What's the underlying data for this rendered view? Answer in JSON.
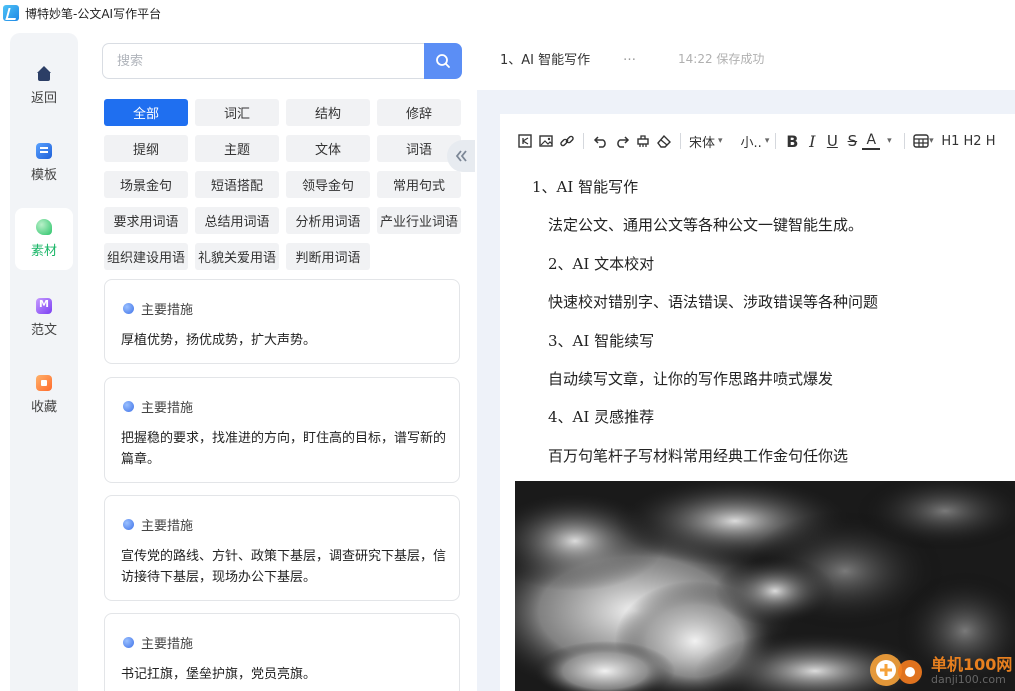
{
  "app": {
    "title": "博特妙笔-公文AI写作平台"
  },
  "nav": [
    {
      "label": "返回",
      "icon": "home-icon"
    },
    {
      "label": "模板",
      "icon": "template-icon"
    },
    {
      "label": "素材",
      "icon": "material-icon",
      "active": true
    },
    {
      "label": "范文",
      "icon": "sample-article-icon"
    },
    {
      "label": "收藏",
      "icon": "favorites-icon"
    }
  ],
  "search": {
    "placeholder": "搜索"
  },
  "tags": [
    "全部",
    "词汇",
    "结构",
    "修辞",
    "提纲",
    "主题",
    "文体",
    "词语",
    "场景金句",
    "短语搭配",
    "领导金句",
    "常用句式",
    "要求用词语",
    "总结用词语",
    "分析用词语",
    "产业行业词语",
    "组织建设用语",
    "礼貌关爱用语",
    "判断用词语"
  ],
  "active_tag": "全部",
  "cards": [
    {
      "title": "主要措施",
      "body": "厚植优势，扬优成势，扩大声势。"
    },
    {
      "title": "主要措施",
      "body": "把握稳的要求，找准进的方向，盯住高的目标，谱写新的篇章。"
    },
    {
      "title": "主要措施",
      "body": "宣传党的路线、方针、政策下基层，调查研究下基层，信访接待下基层，现场办公下基层。"
    },
    {
      "title": "主要措施",
      "body": "书记扛旗，堡垒护旗，党员亮旗。"
    }
  ],
  "document": {
    "title": "1、AI 智能写作",
    "more": "…",
    "save_status": "14:22 保存成功",
    "toolbar": {
      "font": "宋体",
      "size": "小..",
      "headings": "H1 H2 H"
    },
    "lines": [
      "1、AI 智能写作",
      "法定公文、通用公文等各种公文一键智能生成。",
      "2、AI 文本校对",
      "快速校对错别字、语法错误、涉政错误等各种问题",
      "3、AI 智能续写",
      "自动续写文章，让你的写作思路井喷式爆发",
      "4、AI 灵感推荐",
      "百万句笔杆子写材料常用经典工作金句任你选"
    ]
  },
  "watermark": {
    "cn": "单机100网",
    "en": "danji100.com"
  },
  "colors": {
    "accent": "#1f6ff0",
    "active_nav": "#18b566",
    "search_btn": "#5b8ef5",
    "editor_bg": "#eef2f9"
  }
}
